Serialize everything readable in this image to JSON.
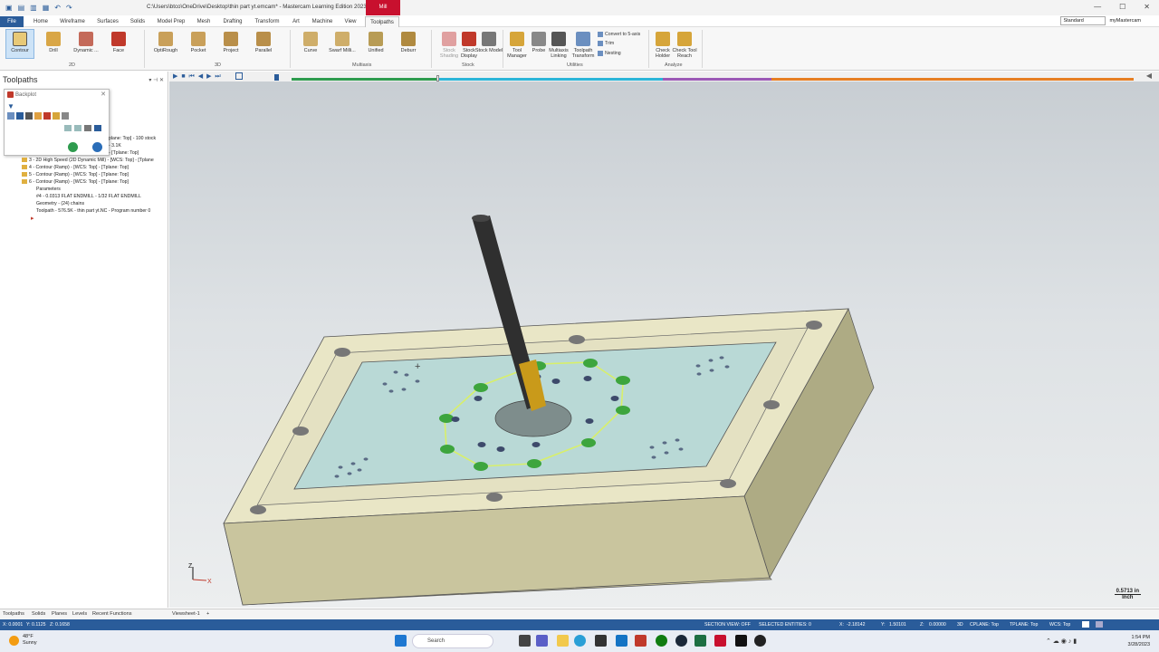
{
  "titlebar": {
    "title": "C:\\Users\\btco\\OneDrive\\Desktop\\thin part yt.emcam* - Mastercam Learning Edition 2023",
    "context_tab": "Mill"
  },
  "menu": {
    "tabs": [
      "File",
      "Home",
      "Wireframe",
      "Surfaces",
      "Solids",
      "Model Prep",
      "Mesh",
      "Drafting",
      "Transform",
      "Art",
      "Machine",
      "View",
      "Toolpaths"
    ],
    "active": "Toolpaths",
    "standard_select": "Standard",
    "my_mastercam": "myMastercam"
  },
  "ribbon": {
    "buttons_2d": [
      "Contour",
      "Drill",
      "Dynamic ...",
      "Face"
    ],
    "buttons_3d": [
      "OptiRough",
      "Pocket",
      "Project",
      "Parallel"
    ],
    "buttons_multiaxis": [
      "Curve",
      "Swarf Milli...",
      "Unified",
      "Deburr"
    ],
    "stock": [
      "Stock Shading",
      "Stock Display",
      "Stock Model"
    ],
    "utilities": [
      "Tool Manager",
      "Probe",
      "Multiaxis Linking",
      "Toolpath Transform"
    ],
    "utilities_small": [
      "Convert to 5-axis",
      "Trim",
      "Nesting"
    ],
    "analyze": [
      "Check Holder",
      "Check Tool Reach"
    ],
    "groups": [
      "2D",
      "3D",
      "Multiaxis",
      "Stock",
      "Utilities",
      "Analyze"
    ]
  },
  "panel": {
    "title": "Toolpaths",
    "backplot_title": "Backplot",
    "tree": [
      "plane: Top] - 100 stock",
      "- 3.1K",
      "- [Tplane: Top]",
      "3 - 2D High Speed (2D Dynamic Mill) - [WCS: Top] - [Tplane",
      "4 - Contour (Ramp) - [WCS: Top] - [Tplane: Top]",
      "5 - Contour (Ramp) - [WCS: Top] - [Tplane: Top]",
      "6 - Contour (Ramp) - [WCS: Top] - [Tplane: Top]",
      "Parameters",
      "#4 - 0.0313 FLAT ENDMILL - 1/32 FLAT ENDMILL",
      "Geometry - (24) chains",
      "Toolpath - 576.5K - thin part yt.NC - Program number 0"
    ]
  },
  "bottom_tabs": [
    "Toolpaths",
    "Solids",
    "Planes",
    "Levels",
    "Recent Functions"
  ],
  "viewsheet": "Viewsheet-1",
  "scale_bar": {
    "value": "0.5713 in",
    "unit": "Inch"
  },
  "status": {
    "x0": "X: 0.0001",
    "y0": "Y: 0.1125",
    "z0": "Z: 0.1658",
    "section_view": "SECTION VIEW: OFF",
    "selected": "SELECTED ENTITIES: 0",
    "x": "X:",
    "x_val": "-2.18142",
    "y": "Y:",
    "y_val": "1.50101",
    "z": "Z:",
    "z_val": "0.00000",
    "mode": "3D",
    "cplane": "CPLANE: Top",
    "tplane": "TPLANE: Top",
    "wcs": "WCS: Top"
  },
  "taskbar": {
    "temp": "48°F",
    "weather": "Sunny",
    "search": "Search",
    "time": "1:54 PM",
    "date": "3/28/2023"
  }
}
